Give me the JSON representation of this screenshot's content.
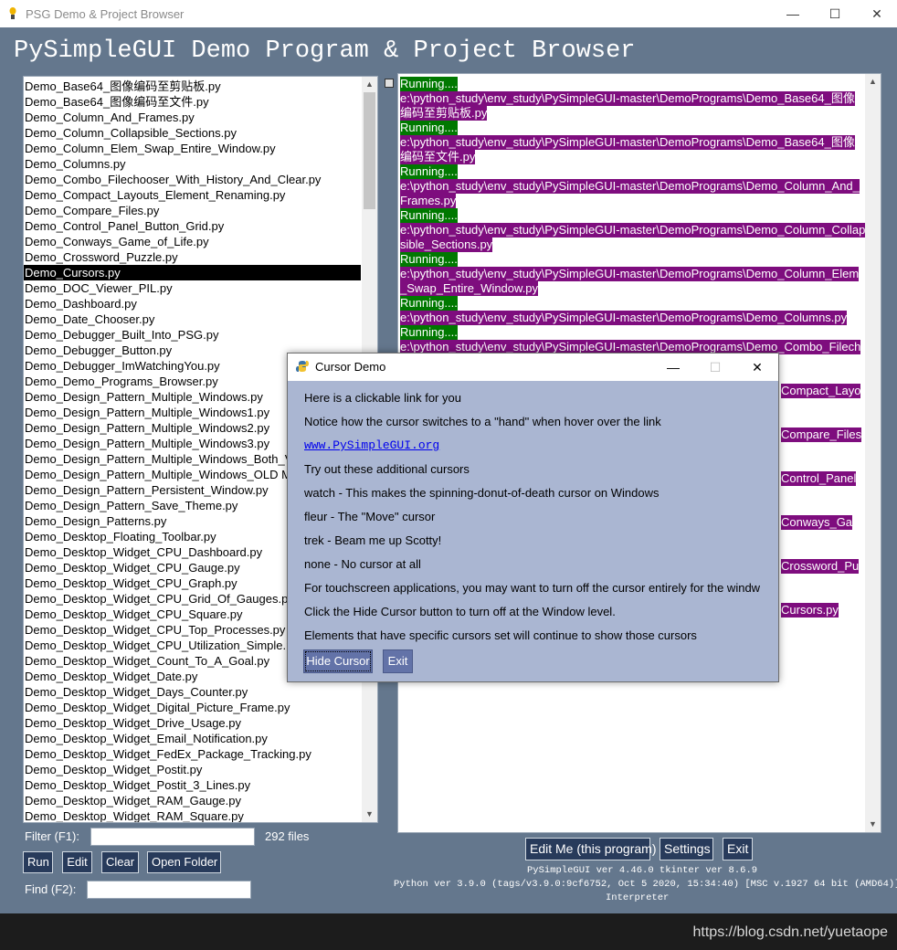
{
  "window": {
    "title": "PSG Demo & Project Browser",
    "min": "—",
    "max": "☐",
    "close": "✕"
  },
  "app_title": "PySimpleGUI Demo Program & Project Browser",
  "files": [
    "Demo_Base64_图像编码至剪贴板.py",
    "Demo_Base64_图像编码至文件.py",
    "Demo_Column_And_Frames.py",
    "Demo_Column_Collapsible_Sections.py",
    "Demo_Column_Elem_Swap_Entire_Window.py",
    "Demo_Columns.py",
    "Demo_Combo_Filechooser_With_History_And_Clear.py",
    "Demo_Compact_Layouts_Element_Renaming.py",
    "Demo_Compare_Files.py",
    "Demo_Control_Panel_Button_Grid.py",
    "Demo_Conways_Game_of_Life.py",
    "Demo_Crossword_Puzzle.py",
    "Demo_Cursors.py",
    "Demo_DOC_Viewer_PIL.py",
    "Demo_Dashboard.py",
    "Demo_Date_Chooser.py",
    "Demo_Debugger_Built_Into_PSG.py",
    "Demo_Debugger_Button.py",
    "Demo_Debugger_ImWatchingYou.py",
    "Demo_Demo_Programs_Browser.py",
    "Demo_Design_Pattern_Multiple_Windows.py",
    "Demo_Design_Pattern_Multiple_Windows1.py",
    "Demo_Design_Pattern_Multiple_Windows2.py",
    "Demo_Design_Pattern_Multiple_Windows3.py",
    "Demo_Design_Pattern_Multiple_Windows_Both_Visible.py",
    "Demo_Design_Pattern_Multiple_Windows_OLD METHOD.py",
    "Demo_Design_Pattern_Persistent_Window.py",
    "Demo_Design_Pattern_Save_Theme.py",
    "Demo_Design_Patterns.py",
    "Demo_Desktop_Floating_Toolbar.py",
    "Demo_Desktop_Widget_CPU_Dashboard.py",
    "Demo_Desktop_Widget_CPU_Gauge.py",
    "Demo_Desktop_Widget_CPU_Graph.py",
    "Demo_Desktop_Widget_CPU_Grid_Of_Gauges.py",
    "Demo_Desktop_Widget_CPU_Square.py",
    "Demo_Desktop_Widget_CPU_Top_Processes.py",
    "Demo_Desktop_Widget_CPU_Utilization_Simple.py",
    "Demo_Desktop_Widget_Count_To_A_Goal.py",
    "Demo_Desktop_Widget_Date.py",
    "Demo_Desktop_Widget_Days_Counter.py",
    "Demo_Desktop_Widget_Digital_Picture_Frame.py",
    "Demo_Desktop_Widget_Drive_Usage.py",
    "Demo_Desktop_Widget_Email_Notification.py",
    "Demo_Desktop_Widget_FedEx_Package_Tracking.py",
    "Demo_Desktop_Widget_Postit.py",
    "Demo_Desktop_Widget_Postit_3_Lines.py",
    "Demo_Desktop_Widget_RAM_Gauge.py",
    "Demo_Desktop_Widget_RAM_Square.py"
  ],
  "selected_index": 12,
  "filter": {
    "label": "Filter (F1):",
    "value": "",
    "count": "292 files"
  },
  "buttons": {
    "run": "Run",
    "edit": "Edit",
    "clear": "Clear",
    "open_folder": "Open Folder"
  },
  "find": {
    "label": "Find (F2):",
    "value": ""
  },
  "output_lines": [
    {
      "text": "Running....",
      "color": "g"
    },
    {
      "text": "e:\\python_study\\env_study\\PySimpleGUI-master\\DemoPrograms\\Demo_Base64_图像",
      "color": "p"
    },
    {
      "text": "编码至剪贴板.py",
      "color": "p"
    },
    {
      "text": "Running....",
      "color": "g"
    },
    {
      "text": "e:\\python_study\\env_study\\PySimpleGUI-master\\DemoPrograms\\Demo_Base64_图像",
      "color": "p"
    },
    {
      "text": "编码至文件.py",
      "color": "p"
    },
    {
      "text": "Running....",
      "color": "g"
    },
    {
      "text": "e:\\python_study\\env_study\\PySimpleGUI-master\\DemoPrograms\\Demo_Column_And_",
      "color": "p"
    },
    {
      "text": "Frames.py",
      "color": "p"
    },
    {
      "text": "Running....",
      "color": "g"
    },
    {
      "text": "e:\\python_study\\env_study\\PySimpleGUI-master\\DemoPrograms\\Demo_Column_Collap",
      "color": "p"
    },
    {
      "text": "sible_Sections.py",
      "color": "p"
    },
    {
      "text": "Running....",
      "color": "g"
    },
    {
      "text": "e:\\python_study\\env_study\\PySimpleGUI-master\\DemoPrograms\\Demo_Column_Elem",
      "color": "p"
    },
    {
      "text": "_Swap_Entire_Window.py",
      "color": "p"
    },
    {
      "text": "Running....",
      "color": "g"
    },
    {
      "text": "e:\\python_study\\env_study\\PySimpleGUI-master\\DemoPrograms\\Demo_Columns.py",
      "color": "p"
    },
    {
      "text": "Running....",
      "color": "g"
    },
    {
      "text": "e:\\python_study\\env_study\\PySimpleGUI-master\\DemoPrograms\\Demo_Combo_Filech",
      "color": "p"
    }
  ],
  "output_tail": [
    {
      "text": "Compact_Layo",
      "row": 21
    },
    {
      "text": "Compare_Files",
      "row": 24
    },
    {
      "text": "Control_Panel",
      "row": 27
    },
    {
      "text": "Conways_Ga",
      "row": 30
    },
    {
      "text": "Crossword_Pu",
      "row": 33
    },
    {
      "text": "Cursors.py",
      "row": 36
    }
  ],
  "bottom_buttons": {
    "edit_me": "Edit Me (this program)",
    "settings": "Settings",
    "exit": "Exit"
  },
  "version": {
    "line1": "PySimpleGUI ver 4.46.0  tkinter ver 8.6.9",
    "line2": "Python ver 3.9.0 (tags/v3.9.0:9cf6752, Oct  5 2020, 15:34:40) [MSC v.1927 64 bit (AMD64)]",
    "line3": "Interpreter"
  },
  "dialog": {
    "title": "Cursor Demo",
    "lines": [
      "Here is a clickable link for you",
      "Notice how the cursor switches to a \"hand\" when hover over the link",
      "Try out these additional cursors",
      "watch - This makes the spinning-donut-of-death cursor on Windows",
      "fleur - The \"Move\" cursor",
      "trek - Beam me up Scotty!",
      "none - No cursor at all",
      "For touchscreen applications, you may want to turn off the cursor entirely for the windw",
      "Click the Hide Cursor button to turn off at the Window level.",
      "Elements that have specific cursors set will continue to show those cursors"
    ],
    "link": "www.PySimpleGUI.org",
    "hide_cursor": "Hide Cursor",
    "exit": "Exit"
  },
  "watermark": "https://blog.csdn.net/yuetaope"
}
